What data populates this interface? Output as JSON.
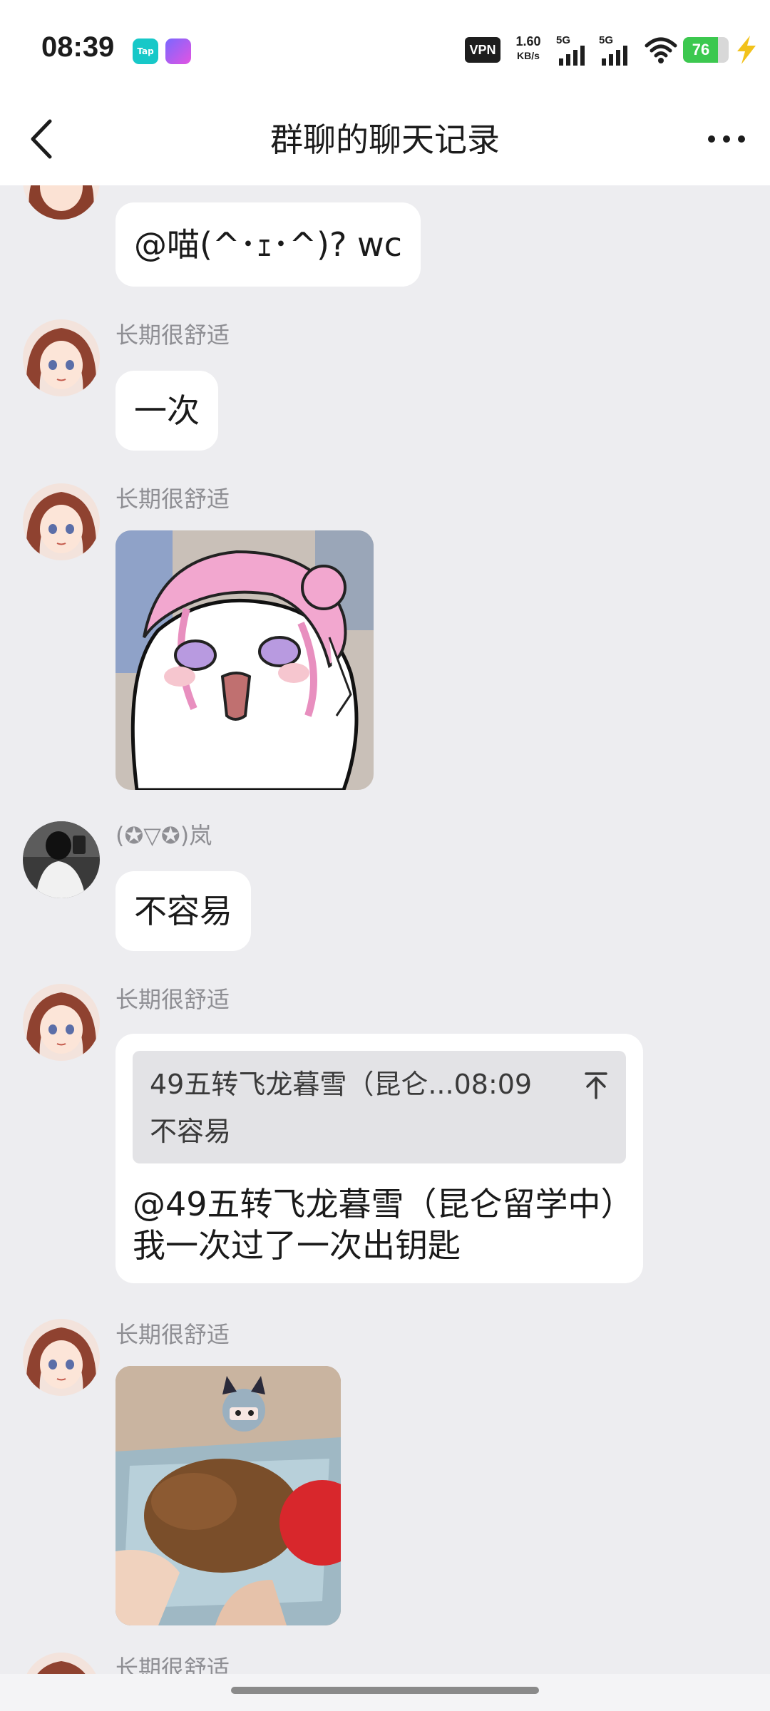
{
  "status_bar": {
    "time": "08:39",
    "tap_badge": "Tap",
    "vpn": "VPN",
    "speed_value": "1.60",
    "speed_unit": "KB/s",
    "signal1": "5G",
    "signal2": "5G",
    "battery": "76",
    "battery_level": 0.76,
    "battery_color": "#3cc84f",
    "icons": [
      "tap-icon",
      "app-icon",
      "vpn-icon",
      "signal-icon",
      "wifi-icon",
      "battery-icon",
      "charging-icon"
    ]
  },
  "nav": {
    "title": "群聊的聊天记录",
    "back_icon": "chevron-left-icon",
    "more_icon": "more-dots-icon"
  },
  "messages": [
    {
      "sender": "",
      "type": "text",
      "text": "@喵(^･ｪ･^)?   wc"
    },
    {
      "sender": "长期很舒适",
      "type": "text",
      "text": "一次"
    },
    {
      "sender": "长期很舒适",
      "type": "sticker",
      "description": "anime-girl-sticker"
    },
    {
      "sender": "(✪▽✪)岚",
      "type": "text",
      "text": "不容易"
    },
    {
      "sender": "长期很舒适",
      "type": "reply",
      "quote_head": "49五转飞龙暮雪（昆仑...08:09",
      "quote_text": "不容易",
      "text_line1": "@49五转飞龙暮雪（昆仑留学中）",
      "text_line2": "我一次过了一次出钥匙"
    },
    {
      "sender": "长期很舒适",
      "type": "sticker",
      "description": "cat-photo-sticker"
    },
    {
      "sender": "长期很舒适",
      "type": "text",
      "text": ""
    }
  ],
  "colors": {
    "background": "#ededf0",
    "bubble": "#ffffff",
    "sender": "#8e8e93",
    "quote_bg": "#e3e3e6"
  }
}
